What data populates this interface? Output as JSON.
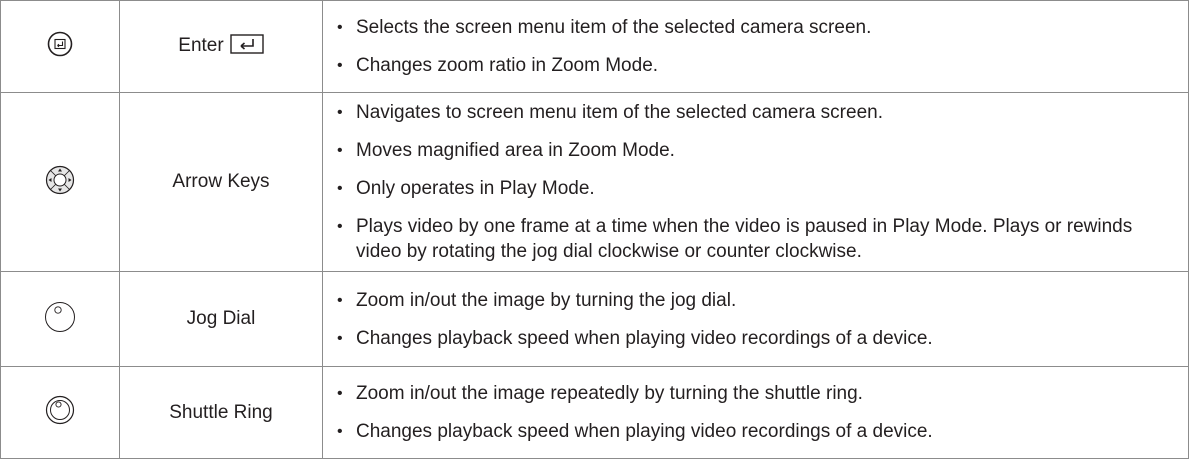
{
  "rows": [
    {
      "icon": "enter-button-icon",
      "name": "Enter",
      "descriptions": [
        "Selects the screen menu item of the selected camera screen.",
        "Changes zoom ratio in Zoom Mode."
      ]
    },
    {
      "icon": "arrow-keys-icon",
      "name": "Arrow Keys",
      "descriptions": [
        "Navigates to screen menu item of the selected camera screen.",
        "Moves magnified area in Zoom Mode.",
        "Only operates in Play Mode.",
        "Plays video by one frame at a time when the video is paused in Play Mode. Plays or rewinds video by rotating the jog dial clockwise or counter clockwise."
      ]
    },
    {
      "icon": "jog-dial-icon",
      "name": "Jog Dial",
      "descriptions": [
        "Zoom in/out the image by turning the jog dial.",
        "Changes playback speed when playing video recordings of a device."
      ]
    },
    {
      "icon": "shuttle-ring-icon",
      "name": "Shuttle Ring",
      "descriptions": [
        "Zoom in/out the image repeatedly by turning the shuttle ring.",
        "Changes playback speed when playing video recordings of a device."
      ]
    }
  ]
}
